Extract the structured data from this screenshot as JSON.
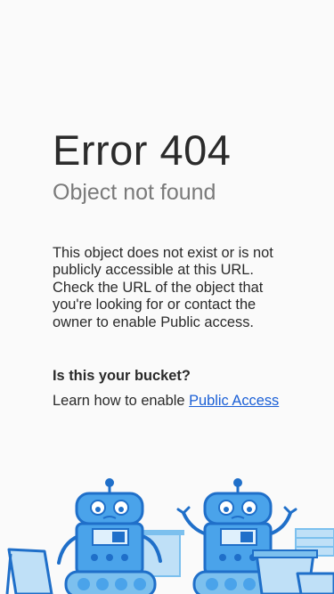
{
  "error": {
    "title": "Error 404",
    "subtitle": "Object not found",
    "description": "This object does not exist or is not publicly accessible at this URL. Check the URL of the object that you're looking for or contact the owner to enable Public access.",
    "question": "Is this your bucket?",
    "learn_prefix": "Learn how to enable ",
    "learn_link": "Public Access"
  },
  "colors": {
    "title": "#2b2b2b",
    "subtitle": "#7a7a7a",
    "link": "#1a5fd6",
    "robot_blue": "#4aa3ea",
    "robot_dark": "#1f6fc9",
    "cup_light": "#bfe0f7"
  },
  "illustration": {
    "icon": "robots-illustration-icon"
  }
}
